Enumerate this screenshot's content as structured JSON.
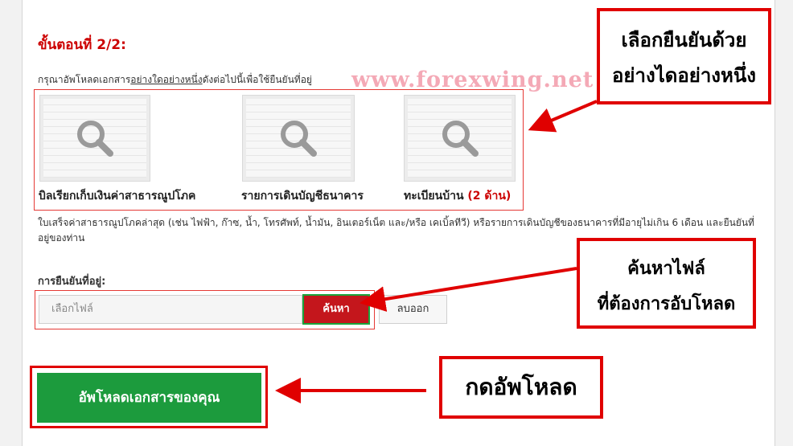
{
  "step_title": "ขั้นตอนที่ 2/2:",
  "instruction": {
    "prefix": "กรุณาอัพโหลดเอกสาร",
    "underlined": "อย่างใดอย่างหนึ่ง",
    "suffix": "ดังต่อไปนี้เพื่อใช้ยืนยันที่อยู่"
  },
  "watermark": "www.forexwing.net",
  "documents": [
    {
      "label": "บิลเรียกเก็บเงินค่าสาธารณูปโภค",
      "extra": "",
      "icon": "magnifier-icon"
    },
    {
      "label": "รายการเดินบัญชีธนาคาร",
      "extra": "",
      "icon": "magnifier-icon"
    },
    {
      "label": "ทะเบียนบ้าน ",
      "extra": "(2 ด้าน)",
      "icon": "magnifier-icon"
    }
  ],
  "description": "ใบเสร็จค่าสาธารณูปโภคล่าสุด (เช่น ไฟฟ้า, ก๊าซ, น้ำ, โทรศัพท์, น้ำมัน, อินเตอร์เน็ต และ/หรือ เคเบิ้ลทีวี) หรือรายการเดินบัญชีของธนาคารที่มีอายุไม่เกิน 6 เดือน และยืนยันที่อยู่ของท่าน",
  "address_label": "การยืนยันที่อยู่:",
  "file_input_placeholder": "เลือกไฟล์",
  "search_button": "ค้นหา",
  "clear_button": "ลบออก",
  "upload_button": "อัพโหลดเอกสารของคุณ",
  "callouts": {
    "choose_one": [
      "เลือกยืนยันด้วย",
      "อย่างไดอย่างหนึ่ง"
    ],
    "find_file": [
      "ค้นหาไฟล์",
      "ที่ต้องการอับโหลด"
    ],
    "press_upload": [
      "กดอัพโหลด"
    ]
  },
  "colors": {
    "accent_red": "#cc0000",
    "upload_green": "#1c9b3d",
    "callout_border": "#e00000"
  }
}
